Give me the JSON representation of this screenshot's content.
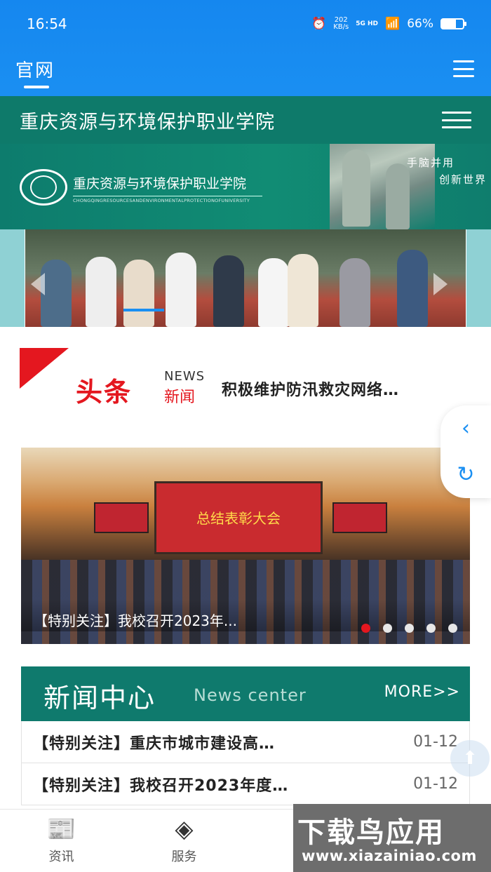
{
  "status_bar": {
    "time": "16:54",
    "net_speed_value": "202",
    "net_speed_unit": "KB/s",
    "network": "5G HD",
    "battery": "66%",
    "battery_level": 0.66
  },
  "app_bar": {
    "tab_label": "官网"
  },
  "site": {
    "title": "重庆资源与环境保护职业学院",
    "banner_name": "重庆资源与环境保护职业学院",
    "banner_en": "CHONGQINGRESOURCESANDENVIRONMENTALPROTECTIONOFUNIVERSITY",
    "slogan_line1": "手脑并用",
    "slogan_line2": "创新世界"
  },
  "headline": {
    "tag_big": "头条",
    "tag_en": "NEWS",
    "tag_cn": "新闻",
    "text": "积极维护防汛救灾网络…"
  },
  "carousel": {
    "stage_text": "总结表彰大会",
    "caption": "【特别关注】我校召开2023年...",
    "active_index": 0,
    "count": 5
  },
  "news_center": {
    "title_cn": "新闻中心",
    "title_en": "News center",
    "more": "MORE>>",
    "items": [
      {
        "title": "【特别关注】重庆市城市建设高…",
        "date": "01-12"
      },
      {
        "title": "【特别关注】我校召开2023年度…",
        "date": "01-12"
      }
    ]
  },
  "bottom_nav": [
    {
      "label": "资讯",
      "icon": "news-icon"
    },
    {
      "label": "服务",
      "icon": "layers-icon"
    }
  ],
  "watermark": {
    "cn": "下载鸟应用",
    "url": "www.xiazainiao.com"
  },
  "colors": {
    "app_blue": "#1587ef",
    "school_green": "#0e7a6a",
    "headline_red": "#e4171f"
  }
}
